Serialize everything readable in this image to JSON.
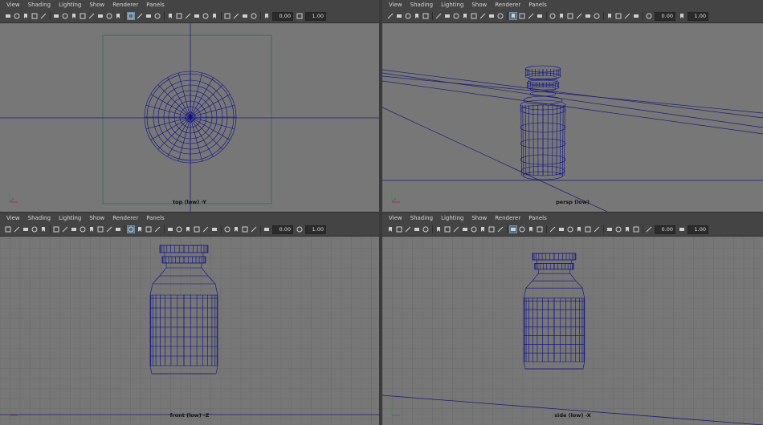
{
  "menus": [
    "View",
    "Shading",
    "Lighting",
    "Show",
    "Renderer",
    "Panels"
  ],
  "toolbar": {
    "field1": "0.00",
    "field2": "1.00",
    "icons": [
      "select-camera-icon",
      "camera-attributes-icon",
      "bookmark-icon",
      "image-plane-icon",
      "grease-pencil-icon",
      "2d-pan-zoom-icon",
      "grid-icon",
      "film-gate-icon",
      "resolution-gate-icon",
      "gate-mask-icon",
      "field-chart-icon",
      "safe-action-icon",
      "safe-title-icon",
      "wireframe-icon",
      "smooth-shade-icon",
      "wireframe-on-shaded-icon",
      "textured-icon",
      "use-all-lights-icon",
      "shadows-icon",
      "screen-space-ao-icon",
      "motion-blur-icon",
      "anti-aliasing-icon",
      "depth-of-field-icon",
      "isolate-select-icon",
      "xray-icon",
      "xray-joints-icon",
      "backface-icon",
      "exposure-icon",
      "gamma-icon"
    ]
  },
  "panels": [
    {
      "id": "top",
      "label": "top (low) -Y"
    },
    {
      "id": "persp",
      "label": "persp (low)"
    },
    {
      "id": "front",
      "label": "front (low) -Z"
    },
    {
      "id": "side",
      "label": "side (low) -X"
    }
  ],
  "colors": {
    "wire": "#0c0c8a",
    "grid": "#6a6a6a",
    "viewport": "#777777",
    "accent": "#4f6e86"
  }
}
